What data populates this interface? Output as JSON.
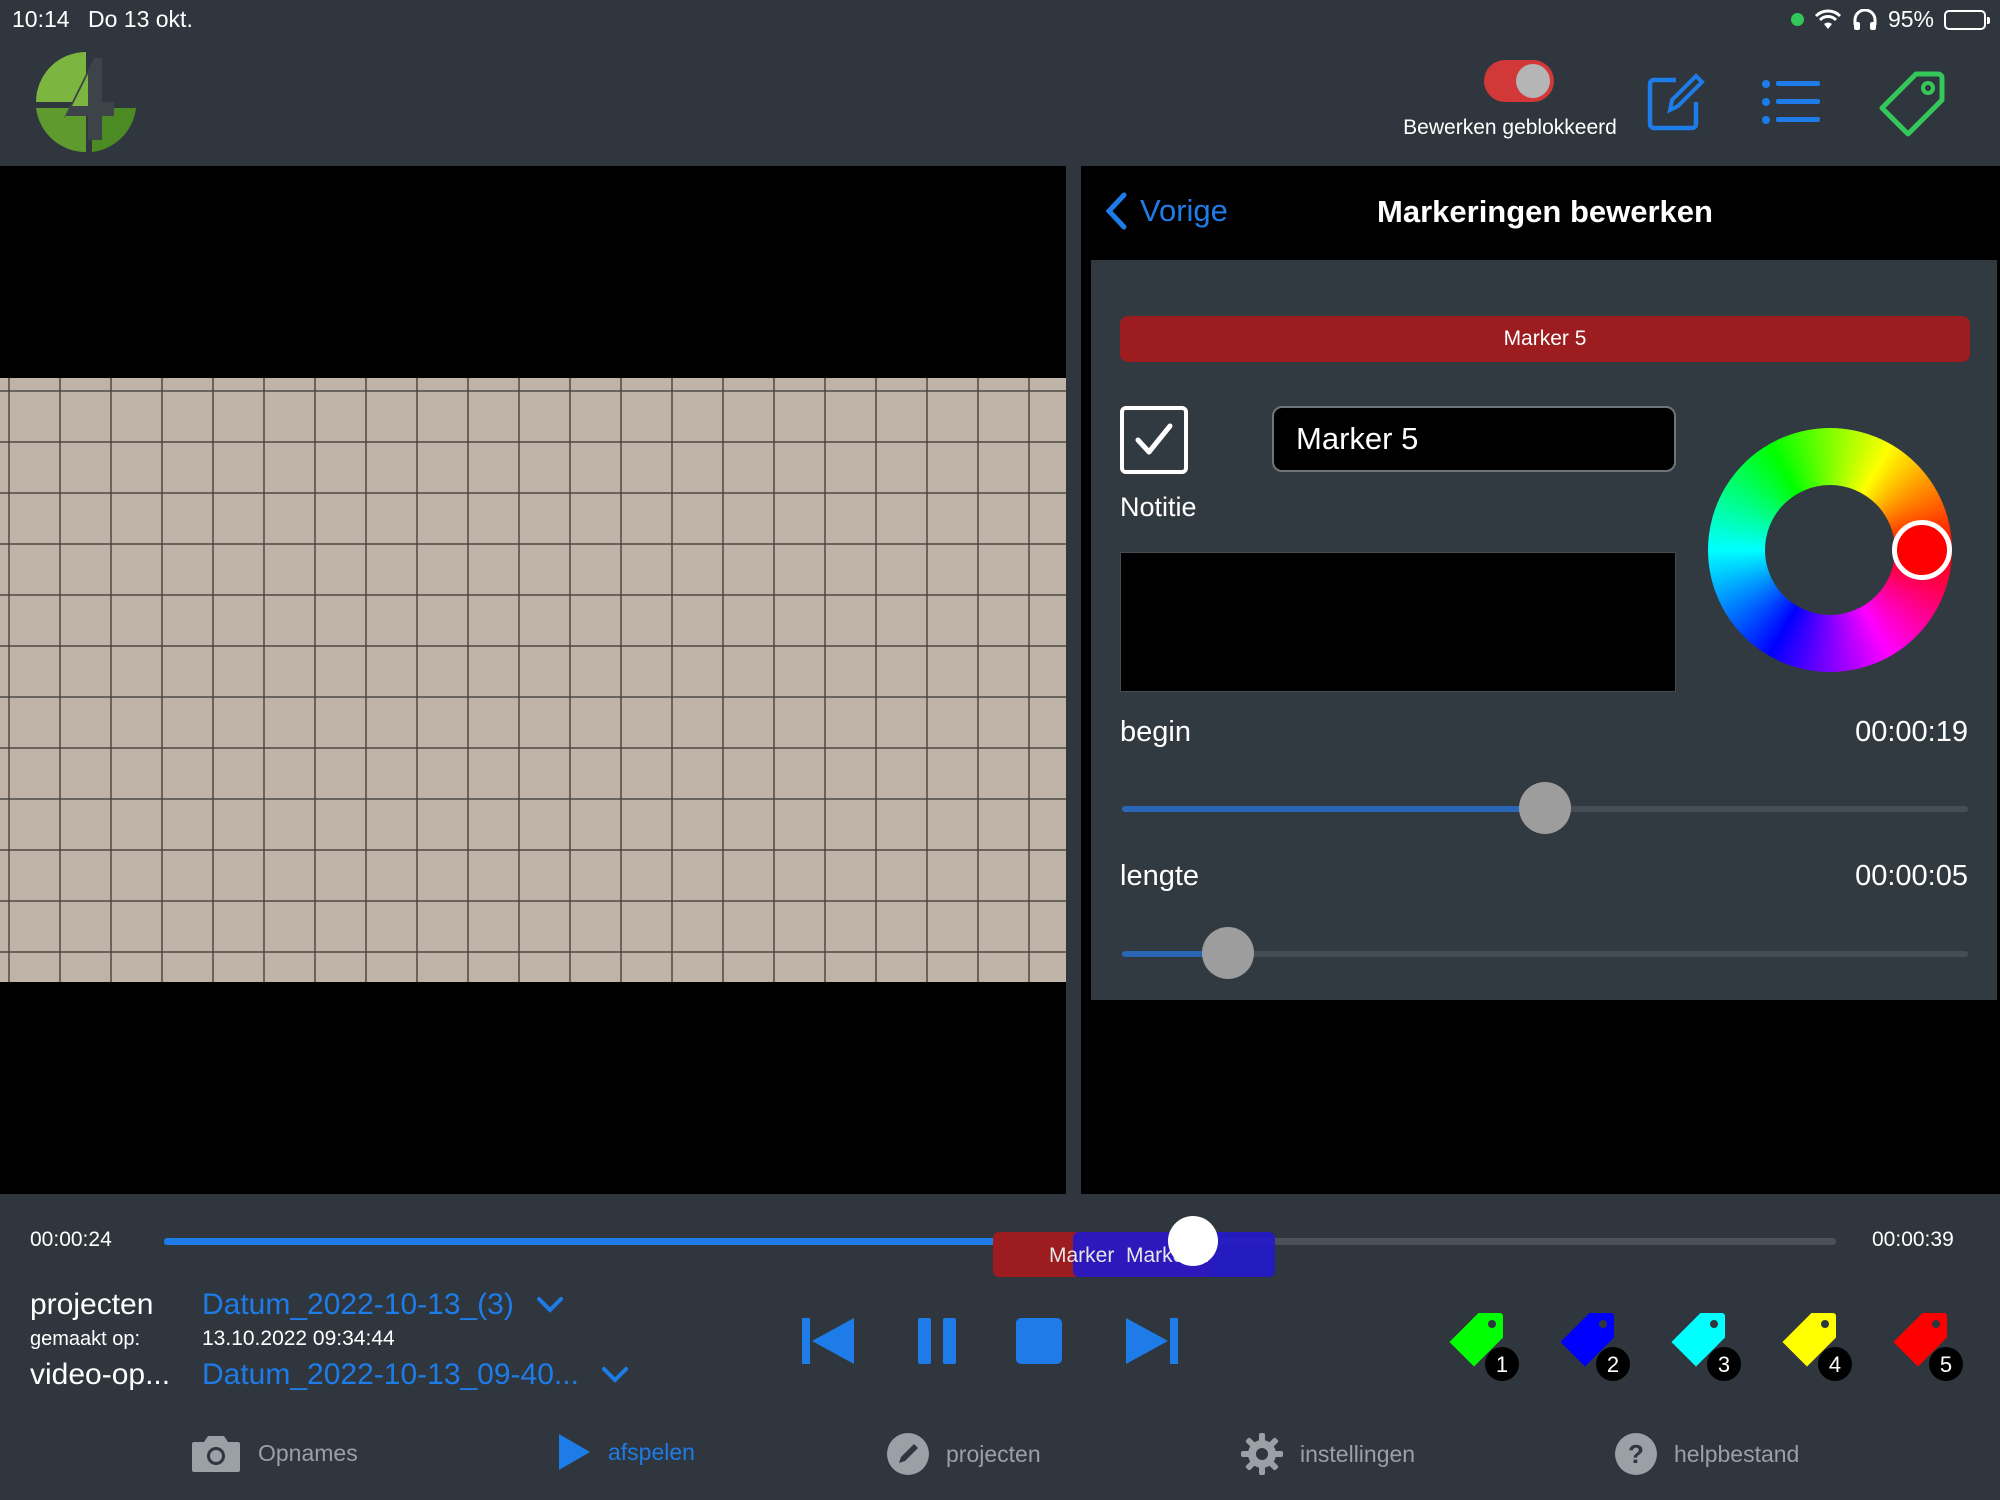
{
  "status_bar": {
    "time": "10:14",
    "date": "Do 13 okt.",
    "battery": "95%"
  },
  "header": {
    "logo_icon": "app-logo-4",
    "toggle_label": "Bewerken geblokkeerd",
    "toggle_on": true,
    "icons": [
      "edit-icon",
      "list-icon",
      "tag-icon"
    ],
    "accent_blue": "#1e7ce8",
    "accent_green": "#34c759"
  },
  "panel": {
    "back_label": "Vorige",
    "title": "Markeringen bewerken",
    "marker_banner": "Marker 5",
    "marker_color": "#9c1c1f",
    "note_checked": true,
    "note_label": "Notitie",
    "name_value": "Marker 5",
    "note_value": "",
    "selected_color": "#ff0000",
    "begin": {
      "label": "begin",
      "value": "00:00:19",
      "fraction": 0.5
    },
    "length": {
      "label": "lengte",
      "value": "00:00:05",
      "fraction": 0.125
    }
  },
  "timeline": {
    "current": "00:00:24",
    "total": "00:00:39",
    "progress": 0.6154,
    "segments": [
      {
        "label": "Marker",
        "color": "#9c1c1f"
      },
      {
        "label": "Marker 2",
        "color": "#2419c9"
      }
    ]
  },
  "info": {
    "project_key": "projecten",
    "project_value": "Datum_2022-10-13_(3)",
    "created_key": "gemaakt op:",
    "created_value": "13.10.2022 09:34:44",
    "video_key": "video-op...",
    "video_value": "Datum_2022-10-13_09-40..."
  },
  "transport": [
    "skip-back-icon",
    "pause-icon",
    "stop-icon",
    "skip-forward-icon"
  ],
  "marker_tags": [
    {
      "number": "1",
      "color": "#00ff00"
    },
    {
      "number": "2",
      "color": "#0000ff"
    },
    {
      "number": "3",
      "color": "#00ffff"
    },
    {
      "number": "4",
      "color": "#ffff00"
    },
    {
      "number": "5",
      "color": "#ff0000"
    }
  ],
  "tabs": [
    {
      "label": "Opnames",
      "icon": "camera-icon",
      "active": false
    },
    {
      "label": "afspelen",
      "icon": "play-icon",
      "active": true
    },
    {
      "label": "projecten",
      "icon": "pencil-icon",
      "active": false
    },
    {
      "label": "instellingen",
      "icon": "gear-icon",
      "active": false
    },
    {
      "label": "helpbestand",
      "icon": "help-icon",
      "active": false
    }
  ]
}
